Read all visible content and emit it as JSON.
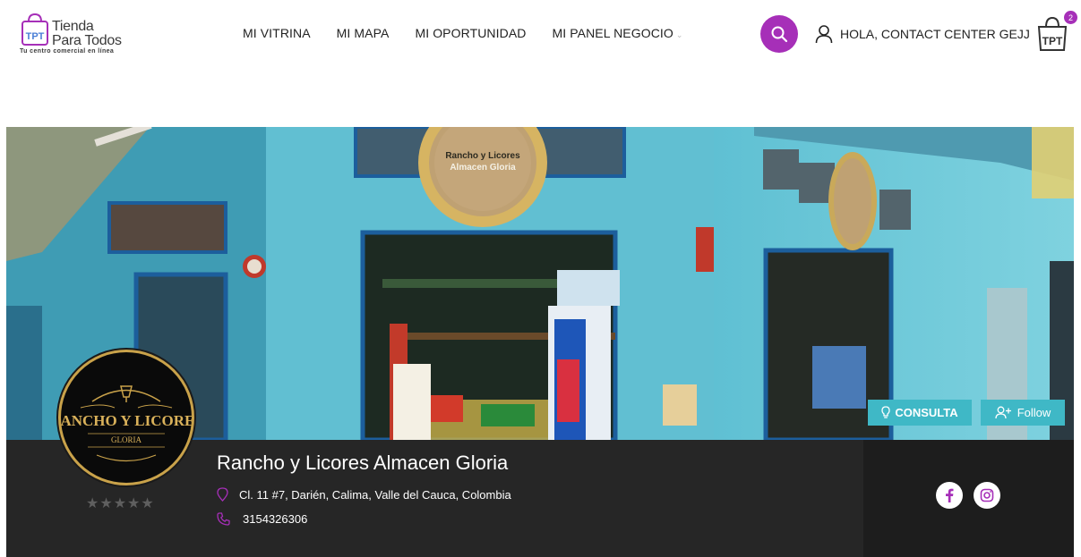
{
  "header": {
    "logo_line1": "Tienda",
    "logo_line2": "Para Todos",
    "logo_tagline": "Tu centro comercial en línea",
    "logo_bag_text": "TPT",
    "nav": [
      {
        "label": "MI VITRINA"
      },
      {
        "label": "MI MAPA"
      },
      {
        "label": "MI OPORTUNIDAD"
      },
      {
        "label": "MI PANEL NEGOCIO"
      }
    ],
    "greeting": "HOLA, CONTACT CENTER GEJJ",
    "cart_count": "2",
    "cart_text": "TPT"
  },
  "banner": {
    "sign_line1": "Rancho y Licores",
    "sign_line2": "Almacen Gloria",
    "consulta_label": "CONSULTA",
    "follow_label": "Follow"
  },
  "store": {
    "logo_line1": "RANCHO Y LICORES",
    "logo_line2": "GLORIA",
    "name": "Rancho y Licores Almacen Gloria",
    "address": "Cl. 11 #7, Darién, Calima, Valle del Cauca, Colombia",
    "phone": "3154326306",
    "rating": 0
  },
  "colors": {
    "accent": "#a62fb8",
    "button_teal": "#3fb8c6",
    "info_bg": "#262626",
    "logo_gold": "#c9a24a"
  },
  "icons": {
    "search": "search-icon",
    "user": "user-icon",
    "cart": "cart-icon",
    "location": "location-pin-icon",
    "phone": "phone-icon",
    "facebook": "facebook-icon",
    "instagram": "instagram-icon"
  }
}
